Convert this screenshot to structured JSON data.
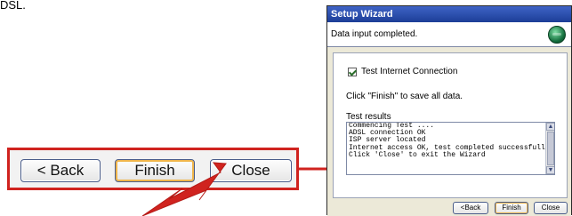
{
  "top_text": "DSL.",
  "callout": {
    "back_label": "< Back",
    "finish_label": "Finish",
    "close_label": "Close",
    "accent_color": "#d0231f"
  },
  "wizard": {
    "title": "Setup Wizard",
    "header_message": "Data input completed.",
    "checkbox_label": "Test Internet Connection",
    "finish_instruction": "Click \"Finish\" to save all data.",
    "results_label": "Test results",
    "results_lines": [
      "Commencing Test ....",
      "ADSL connection OK",
      "ISP server located",
      "Internet access OK, test completed successfully",
      "Click 'Close' to exit the Wizard"
    ],
    "buttons": {
      "back_label": "<Back",
      "finish_label": "Finish",
      "close_label": "Close"
    },
    "icons": {
      "header_icon": "globe-icon",
      "scroll_up": "scroll-up-arrow-icon",
      "scroll_down": "scroll-down-arrow-icon"
    }
  }
}
